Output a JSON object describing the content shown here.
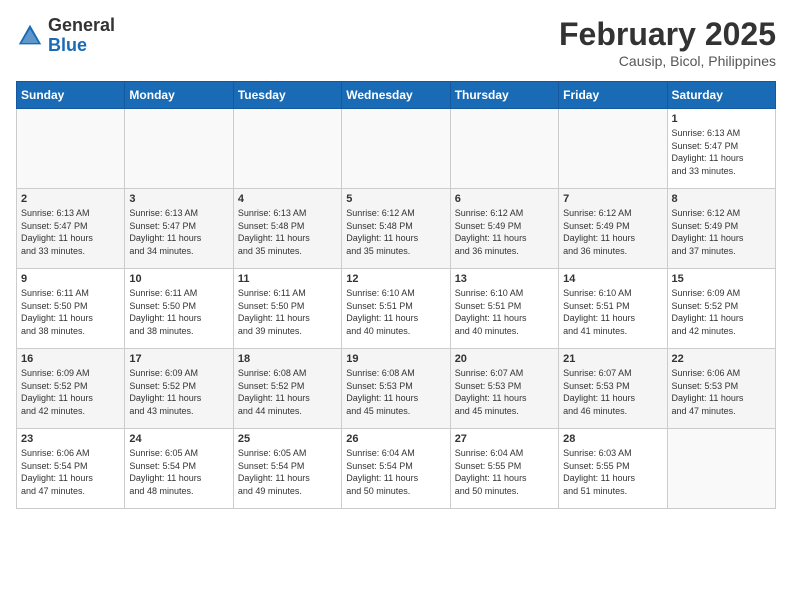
{
  "header": {
    "logo_general": "General",
    "logo_blue": "Blue",
    "month_year": "February 2025",
    "location": "Causip, Bicol, Philippines"
  },
  "weekdays": [
    "Sunday",
    "Monday",
    "Tuesday",
    "Wednesday",
    "Thursday",
    "Friday",
    "Saturday"
  ],
  "weeks": [
    [
      {
        "day": "",
        "info": ""
      },
      {
        "day": "",
        "info": ""
      },
      {
        "day": "",
        "info": ""
      },
      {
        "day": "",
        "info": ""
      },
      {
        "day": "",
        "info": ""
      },
      {
        "day": "",
        "info": ""
      },
      {
        "day": "1",
        "info": "Sunrise: 6:13 AM\nSunset: 5:47 PM\nDaylight: 11 hours\nand 33 minutes."
      }
    ],
    [
      {
        "day": "2",
        "info": "Sunrise: 6:13 AM\nSunset: 5:47 PM\nDaylight: 11 hours\nand 33 minutes."
      },
      {
        "day": "3",
        "info": "Sunrise: 6:13 AM\nSunset: 5:47 PM\nDaylight: 11 hours\nand 34 minutes."
      },
      {
        "day": "4",
        "info": "Sunrise: 6:13 AM\nSunset: 5:48 PM\nDaylight: 11 hours\nand 35 minutes."
      },
      {
        "day": "5",
        "info": "Sunrise: 6:12 AM\nSunset: 5:48 PM\nDaylight: 11 hours\nand 35 minutes."
      },
      {
        "day": "6",
        "info": "Sunrise: 6:12 AM\nSunset: 5:49 PM\nDaylight: 11 hours\nand 36 minutes."
      },
      {
        "day": "7",
        "info": "Sunrise: 6:12 AM\nSunset: 5:49 PM\nDaylight: 11 hours\nand 36 minutes."
      },
      {
        "day": "8",
        "info": "Sunrise: 6:12 AM\nSunset: 5:49 PM\nDaylight: 11 hours\nand 37 minutes."
      }
    ],
    [
      {
        "day": "9",
        "info": "Sunrise: 6:11 AM\nSunset: 5:50 PM\nDaylight: 11 hours\nand 38 minutes."
      },
      {
        "day": "10",
        "info": "Sunrise: 6:11 AM\nSunset: 5:50 PM\nDaylight: 11 hours\nand 38 minutes."
      },
      {
        "day": "11",
        "info": "Sunrise: 6:11 AM\nSunset: 5:50 PM\nDaylight: 11 hours\nand 39 minutes."
      },
      {
        "day": "12",
        "info": "Sunrise: 6:10 AM\nSunset: 5:51 PM\nDaylight: 11 hours\nand 40 minutes."
      },
      {
        "day": "13",
        "info": "Sunrise: 6:10 AM\nSunset: 5:51 PM\nDaylight: 11 hours\nand 40 minutes."
      },
      {
        "day": "14",
        "info": "Sunrise: 6:10 AM\nSunset: 5:51 PM\nDaylight: 11 hours\nand 41 minutes."
      },
      {
        "day": "15",
        "info": "Sunrise: 6:09 AM\nSunset: 5:52 PM\nDaylight: 11 hours\nand 42 minutes."
      }
    ],
    [
      {
        "day": "16",
        "info": "Sunrise: 6:09 AM\nSunset: 5:52 PM\nDaylight: 11 hours\nand 42 minutes."
      },
      {
        "day": "17",
        "info": "Sunrise: 6:09 AM\nSunset: 5:52 PM\nDaylight: 11 hours\nand 43 minutes."
      },
      {
        "day": "18",
        "info": "Sunrise: 6:08 AM\nSunset: 5:52 PM\nDaylight: 11 hours\nand 44 minutes."
      },
      {
        "day": "19",
        "info": "Sunrise: 6:08 AM\nSunset: 5:53 PM\nDaylight: 11 hours\nand 45 minutes."
      },
      {
        "day": "20",
        "info": "Sunrise: 6:07 AM\nSunset: 5:53 PM\nDaylight: 11 hours\nand 45 minutes."
      },
      {
        "day": "21",
        "info": "Sunrise: 6:07 AM\nSunset: 5:53 PM\nDaylight: 11 hours\nand 46 minutes."
      },
      {
        "day": "22",
        "info": "Sunrise: 6:06 AM\nSunset: 5:53 PM\nDaylight: 11 hours\nand 47 minutes."
      }
    ],
    [
      {
        "day": "23",
        "info": "Sunrise: 6:06 AM\nSunset: 5:54 PM\nDaylight: 11 hours\nand 47 minutes."
      },
      {
        "day": "24",
        "info": "Sunrise: 6:05 AM\nSunset: 5:54 PM\nDaylight: 11 hours\nand 48 minutes."
      },
      {
        "day": "25",
        "info": "Sunrise: 6:05 AM\nSunset: 5:54 PM\nDaylight: 11 hours\nand 49 minutes."
      },
      {
        "day": "26",
        "info": "Sunrise: 6:04 AM\nSunset: 5:54 PM\nDaylight: 11 hours\nand 50 minutes."
      },
      {
        "day": "27",
        "info": "Sunrise: 6:04 AM\nSunset: 5:55 PM\nDaylight: 11 hours\nand 50 minutes."
      },
      {
        "day": "28",
        "info": "Sunrise: 6:03 AM\nSunset: 5:55 PM\nDaylight: 11 hours\nand 51 minutes."
      },
      {
        "day": "",
        "info": ""
      }
    ]
  ]
}
